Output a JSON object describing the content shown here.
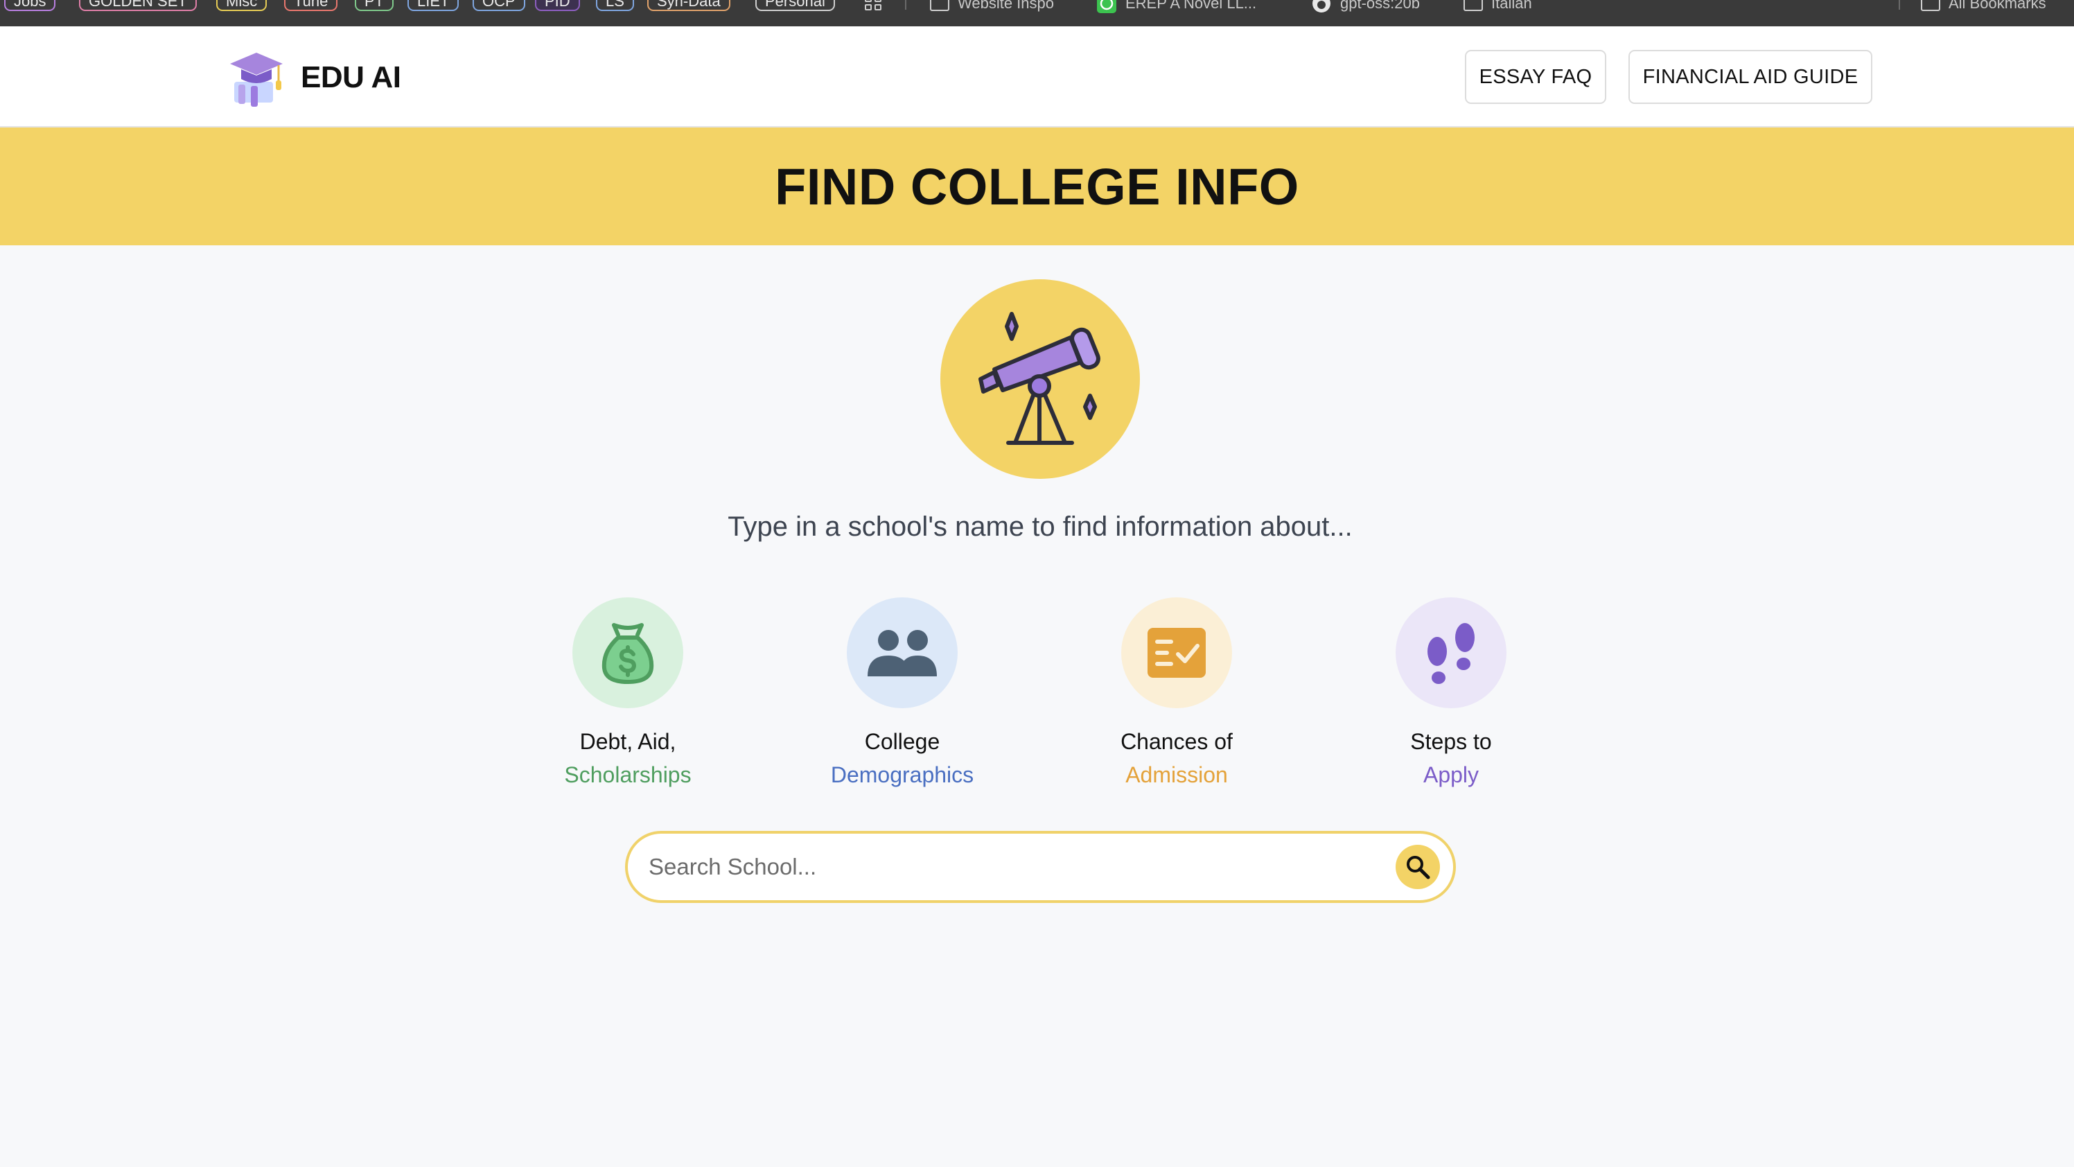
{
  "bookmarks_bar": {
    "items": [
      {
        "label": "Jobs",
        "color": "#b87fe0"
      },
      {
        "label": "GOLDEN SET",
        "color": "#e07fa8"
      },
      {
        "label": "Misc",
        "color": "#e6cc55"
      },
      {
        "label": "Tune",
        "color": "#e8776e"
      },
      {
        "label": "PT",
        "color": "#7fc98b"
      },
      {
        "label": "LIET",
        "color": "#7fa6e0"
      },
      {
        "label": "OCP",
        "color": "#7fa6e0"
      },
      {
        "label": "PID",
        "color": "#8d5fc0"
      },
      {
        "label": "LS",
        "color": "#7fa6e0"
      },
      {
        "label": "Syn-Data",
        "color": "#e0a26b"
      },
      {
        "label": "Personal",
        "color": "#cfcfcf"
      }
    ],
    "links": [
      "Website Inspo",
      "EREP A Novel LL...",
      "gpt-oss:20b",
      "Italian"
    ],
    "all_bookmarks": "All Bookmarks"
  },
  "header": {
    "brand": "EDU AI",
    "nav": [
      "ESSAY FAQ",
      "FINANCIAL AID GUIDE"
    ]
  },
  "banner": {
    "title": "FIND COLLEGE INFO"
  },
  "main": {
    "hero_icon": "telescope-icon",
    "tagline": "Type in a school's name to find information about...",
    "features": [
      {
        "line1": "Debt, Aid,",
        "line2": "Scholarships",
        "icon": "money-bag-icon",
        "accent": "#4f9e5f",
        "bg": "#d9f1de"
      },
      {
        "line1": "College",
        "line2": "Demographics",
        "icon": "people-icon",
        "accent": "#4a6fc1",
        "bg": "#dce8f8"
      },
      {
        "line1": "Chances of",
        "line2": "Admission",
        "icon": "checklist-icon",
        "accent": "#e4a23a",
        "bg": "#fbefd6"
      },
      {
        "line1": "Steps to",
        "line2": "Apply",
        "icon": "footsteps-icon",
        "accent": "#7b5cc8",
        "bg": "#ebe6f8"
      }
    ]
  },
  "search": {
    "placeholder": "Search School...",
    "value": "",
    "icon": "search-icon"
  },
  "colors": {
    "banner": "#f3d366",
    "search_border": "#f0d26a",
    "brand_purple": "#a685dd"
  }
}
